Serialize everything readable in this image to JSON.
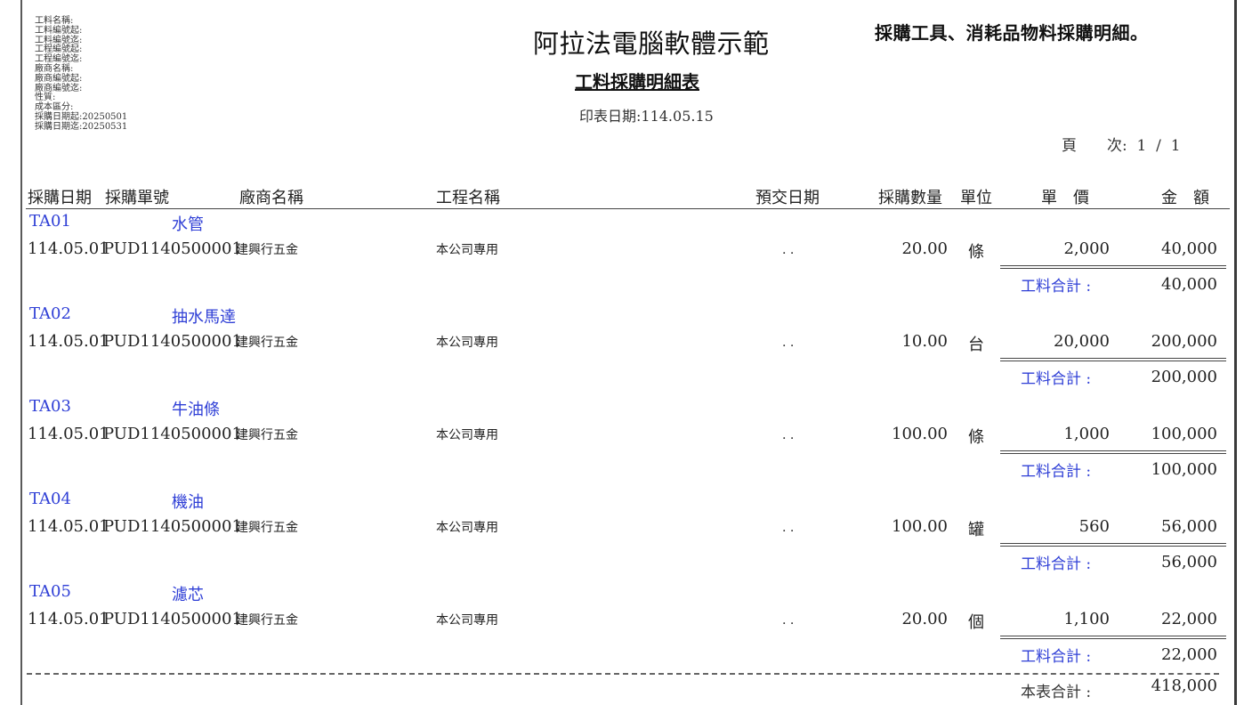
{
  "filters": [
    "工料名稱:",
    "工料編號起:",
    "工料編號迄:",
    "工程編號起:",
    "工程編號迄:",
    "廠商名稱:",
    "廠商編號起:",
    "廠商編號迄:",
    "性質:",
    "成本區分:",
    "採購日期起:20250501",
    "採購日期迄:20250531"
  ],
  "company": "阿拉法電腦軟體示範",
  "report_title": "工料採購明細表",
  "print_date": "印表日期:114.05.15",
  "note": "採購工具、消耗品物料採購明細。",
  "page": "頁　　次:  1  /  1",
  "columns": {
    "date": "採購日期",
    "po": "採購單號",
    "vendor": "廠商名稱",
    "project": "工程名稱",
    "delivery": "預交日期",
    "qty": "採購數量",
    "unit": "單位",
    "price": "單　價",
    "amount": "金　額"
  },
  "groups": [
    {
      "code": "TA01",
      "name": "水管",
      "date": "114.05.01",
      "po": "PUD1140500001",
      "vendor": "建興行五金",
      "project": "本公司專用",
      "delivery": ". .",
      "qty": "20.00",
      "unit": "條",
      "price": "2,000",
      "amount": "40,000",
      "subtotal_label": "工料合計 :",
      "subtotal": "40,000"
    },
    {
      "code": "TA02",
      "name": "抽水馬達",
      "date": "114.05.01",
      "po": "PUD1140500001",
      "vendor": "建興行五金",
      "project": "本公司專用",
      "delivery": ". .",
      "qty": "10.00",
      "unit": "台",
      "price": "20,000",
      "amount": "200,000",
      "subtotal_label": "工料合計 :",
      "subtotal": "200,000"
    },
    {
      "code": "TA03",
      "name": "牛油條",
      "date": "114.05.01",
      "po": "PUD1140500001",
      "vendor": "建興行五金",
      "project": "本公司專用",
      "delivery": ". .",
      "qty": "100.00",
      "unit": "條",
      "price": "1,000",
      "amount": "100,000",
      "subtotal_label": "工料合計 :",
      "subtotal": "100,000"
    },
    {
      "code": "TA04",
      "name": "機油",
      "date": "114.05.01",
      "po": "PUD1140500001",
      "vendor": "建興行五金",
      "project": "本公司專用",
      "delivery": ". .",
      "qty": "100.00",
      "unit": "罐",
      "price": "560",
      "amount": "56,000",
      "subtotal_label": "工料合計 :",
      "subtotal": "56,000"
    },
    {
      "code": "TA05",
      "name": "濾芯",
      "date": "114.05.01",
      "po": "PUD1140500001",
      "vendor": "建興行五金",
      "project": "本公司專用",
      "delivery": ". .",
      "qty": "20.00",
      "unit": "個",
      "price": "1,100",
      "amount": "22,000",
      "subtotal_label": "工料合計 :",
      "subtotal": "22,000"
    }
  ],
  "grand_total_label": "本表合計 :",
  "grand_total": "418,000"
}
